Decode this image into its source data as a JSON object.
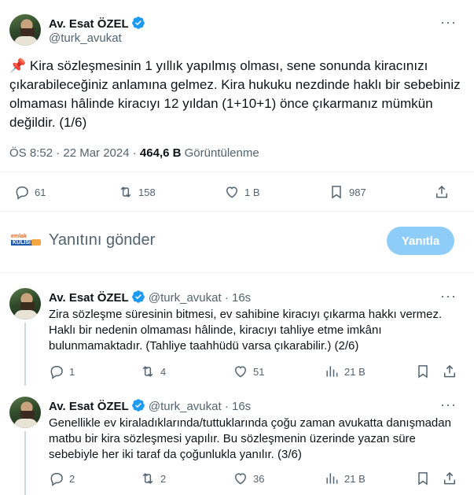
{
  "main_tweet": {
    "name": "Av. Esat ÖZEL",
    "handle": "@turk_avukat",
    "pin_emoji": "📌",
    "text": "Kira sözleşmesinin 1 yıllık yapılmış olması, sene sonunda kiracınızı çıkarabileceğiniz anlamına gelmez. Kira hukuku nezdinde haklı bir sebebiniz olmaması hâlinde kiracıyı 12 yıldan  (1+10+1) önce çıkarmanız mümkün değildir. (1/6)",
    "time": "ÖS 8:52 · 22 Mar 2024 · ",
    "views_count": "464,6 B",
    "views_label": " Görüntülenme",
    "actions": {
      "replies": "61",
      "retweets": "158",
      "likes": "1 B",
      "bookmarks": "987"
    }
  },
  "composer": {
    "logo_top": "emlak",
    "logo_bottom": "KULİSİ",
    "placeholder": "Yanıtını gönder",
    "button": "Yanıtla"
  },
  "replies": [
    {
      "name": "Av. Esat ÖZEL",
      "handle": "@turk_avukat",
      "time": "· 16s",
      "text": "Zira sözleşme süresinin bitmesi, ev sahibine kiracıyı çıkarma hakkı vermez. Haklı bir nedenin olmaması hâlinde, kiracıyı tahliye etme imkânı bulunmamaktadır. (Tahliye taahhüdü varsa çıkarabilir.) (2/6)",
      "actions": {
        "replies": "1",
        "retweets": "4",
        "likes": "51",
        "views": "21 B"
      }
    },
    {
      "name": "Av. Esat ÖZEL",
      "handle": "@turk_avukat",
      "time": "· 16s",
      "text": "Genellikle ev kiraladıklarında/tuttuklarında çoğu zaman avukatta danışmadan matbu bir kira sözleşmesi yapılır. Bu sözleşmenin üzerinde yazan süre sebebiyle her iki taraf da çoğunlukla yanılır. (3/6)",
      "actions": {
        "replies": "2",
        "retweets": "2",
        "likes": "36",
        "views": "21 B"
      }
    }
  ],
  "colors": {
    "accent": "#1d9bf0",
    "button_disabled": "#8ecdf8",
    "muted": "#536471"
  }
}
